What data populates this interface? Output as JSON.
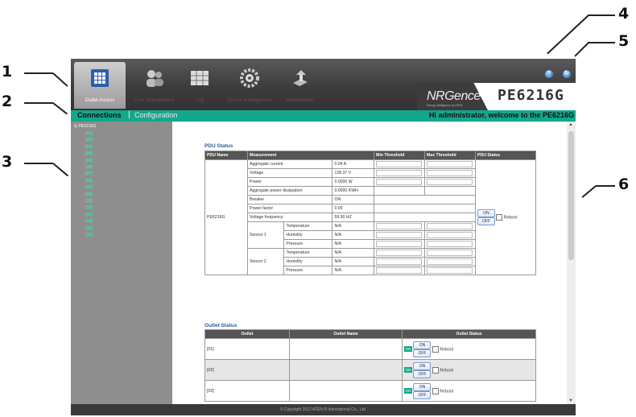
{
  "callouts": [
    "1",
    "2",
    "3",
    "4",
    "5",
    "6"
  ],
  "topnav": {
    "items": [
      {
        "label": "Outlet Access",
        "icon": "outlet-access-icon"
      },
      {
        "label": "User Management",
        "icon": "users-icon"
      },
      {
        "label": "Log",
        "icon": "log-icon"
      },
      {
        "label": "Device Management",
        "icon": "device-gear-icon"
      },
      {
        "label": "Maintenance",
        "icon": "maintenance-icon"
      }
    ],
    "help": "?",
    "logout": "↻"
  },
  "brand": {
    "logo": "NRGence",
    "tagline": "Energy Intelligence by ATEN",
    "model": "PE6216G"
  },
  "subtabs": {
    "connections": "Connections",
    "separator": "|",
    "configuration": "Configuration"
  },
  "welcome": "Hi administrator, welcome to the PE6216G",
  "tree": {
    "root": "PE6216G",
    "items": [
      "[01]",
      "[02]",
      "[03]",
      "[04]",
      "[05]",
      "[06]",
      "[07]",
      "[08]",
      "[09]",
      "[10]",
      "[11]",
      "[12]",
      "[13]",
      "[14]",
      "[15]",
      "[16]"
    ]
  },
  "pdu_status": {
    "title": "PDU Status",
    "headers": [
      "PDU Name",
      "Measurement",
      "Min Threshold",
      "Max Threshold",
      "PDU Status"
    ],
    "pdu_name": "PE6216G",
    "rows": [
      {
        "m": "Aggregate current",
        "v": "0.04 A"
      },
      {
        "m": "Voltage",
        "v": "128.37 V"
      },
      {
        "m": "Power",
        "v": "0.0000 W"
      },
      {
        "m": "Aggregate power dissipation",
        "v": "0.0000 KWH"
      },
      {
        "m": "Breaker",
        "v": "ON"
      },
      {
        "m": "Power factor",
        "v": "0.00"
      },
      {
        "m": "Voltage frequency",
        "v": "59.90 HZ"
      }
    ],
    "sensor1": "Sensor 1",
    "sensor2": "Sensor 2",
    "sensor_rows": [
      {
        "m": "Temperature",
        "v": "N/A"
      },
      {
        "m": "Humidity",
        "v": "N/A"
      },
      {
        "m": "Pressure",
        "v": "N/A"
      }
    ],
    "on": "ON",
    "off": "OFF",
    "reboot": "Reboot"
  },
  "outlet_status": {
    "title": "Outlet Status",
    "headers": [
      "Outlet",
      "Outlet Name",
      "Outlet Status"
    ],
    "rows": [
      {
        "outlet": "[01]",
        "state": "ON"
      },
      {
        "outlet": "[02]",
        "state": "ON"
      },
      {
        "outlet": "[03]",
        "state": "ON"
      }
    ],
    "on": "ON",
    "off": "OFF",
    "reboot": "Reboot"
  },
  "footer": "© Copyright 2012 ATEN ® International Co., Ltd."
}
